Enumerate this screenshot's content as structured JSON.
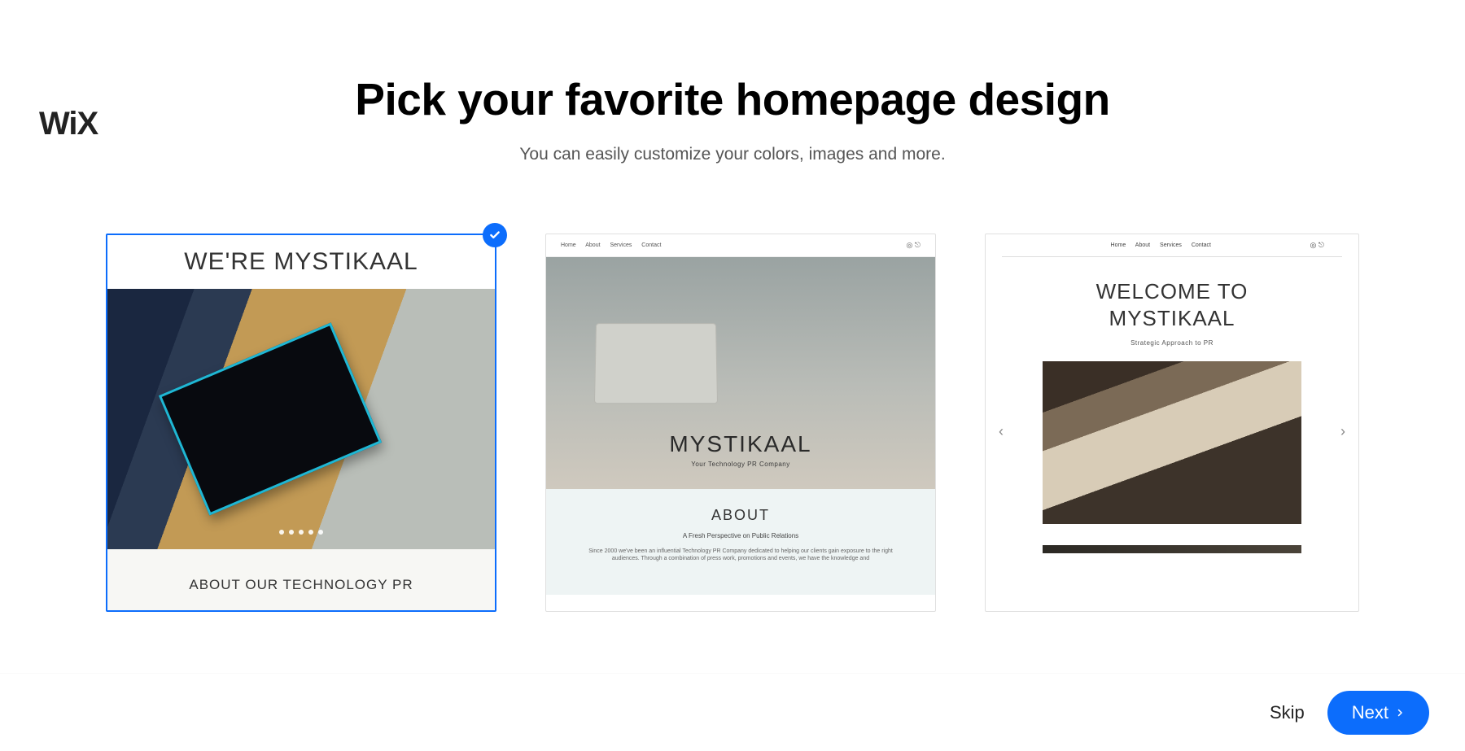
{
  "logo": "WiX",
  "heading": {
    "title": "Pick your favorite homepage design",
    "subtitle": "You can easily customize your colors, images and more."
  },
  "templates": [
    {
      "selected": true,
      "title": "WE'RE MYSTIKAAL",
      "about_heading": "ABOUT OUR TECHNOLOGY PR"
    },
    {
      "nav": [
        "Home",
        "About",
        "Services",
        "Contact"
      ],
      "brand": "MYSTIKAAL",
      "tagline": "Your Technology PR Company",
      "about_heading": "ABOUT",
      "about_sub": "A Fresh Perspective on Public Relations",
      "about_text": "Since 2000 we've been an influential Technology PR Company dedicated to helping our clients gain exposure to the right audiences. Through a combination of press work, promotions and events, we have the knowledge and"
    },
    {
      "nav": [
        "Home",
        "About",
        "Services",
        "Contact"
      ],
      "title_line1": "WELCOME TO",
      "title_line2": "MYSTIKAAL",
      "subtitle": "Strategic Approach to PR"
    }
  ],
  "footer": {
    "skip": "Skip",
    "next": "Next"
  }
}
